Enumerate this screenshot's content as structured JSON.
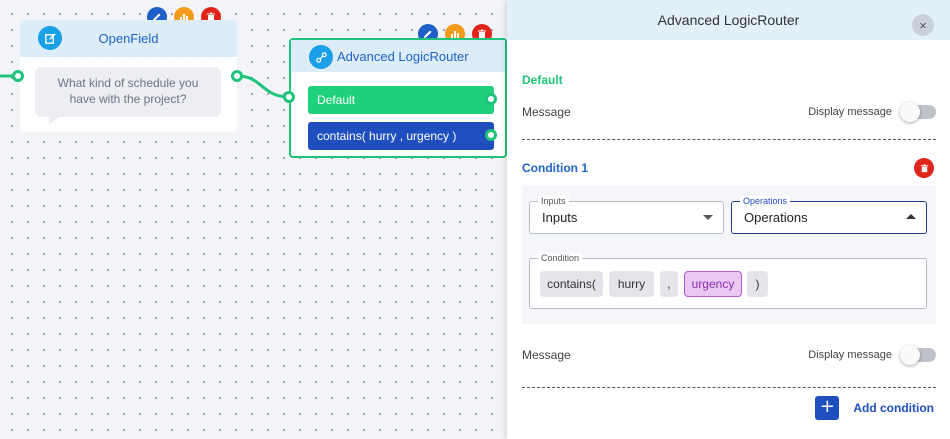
{
  "nodes": {
    "openfield": {
      "title": "OpenField",
      "question": "What kind of schedule you have with the project?"
    },
    "router": {
      "title": "Advanced LogicRouter",
      "routes": [
        "Default",
        "contains( hurry , urgency )"
      ]
    }
  },
  "panel": {
    "title": "Advanced LogicRouter",
    "close_icon": "×",
    "default_section": {
      "label": "Default",
      "message_label": "Message",
      "display_message_label": "Display message",
      "display_message_on": false
    },
    "condition": {
      "label": "Condition 1",
      "inputs_legend": "Inputs",
      "inputs_value": "Inputs",
      "operations_legend": "Operations",
      "operations_value": "Operations",
      "condition_legend": "Condition",
      "tokens": [
        "contains(",
        "hurry",
        ",",
        "urgency",
        ")"
      ],
      "message_label": "Message",
      "display_message_label": "Display message",
      "display_message_on": false
    },
    "add_condition_label": "Add condition",
    "add_icon": "+"
  },
  "colors": {
    "accent_green": "#1fc37a",
    "accent_blue": "#1f4fbf",
    "delete_red": "#e1251b",
    "stats_orange": "#f29a1a"
  }
}
